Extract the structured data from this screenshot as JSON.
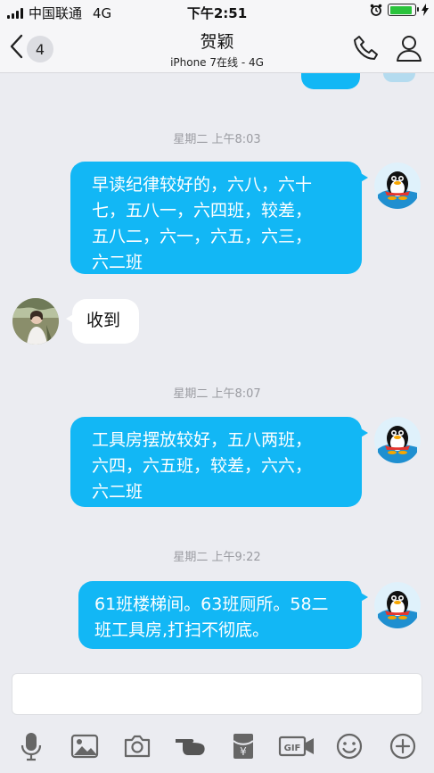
{
  "status_bar": {
    "carrier": "中国联通",
    "network": "4G",
    "time": "下午2:51",
    "battery_level": 0.9,
    "icons": [
      "signal-icon",
      "alarm-icon",
      "battery-icon",
      "charging-icon"
    ]
  },
  "header": {
    "back_count": "4",
    "title": "贺颖",
    "subtitle": "iPhone 7在线 - 4G",
    "icons": [
      "phone-icon",
      "profile-icon"
    ]
  },
  "messages": [
    {
      "timestamp": "星期二 上午8:03"
    },
    {
      "direction": "out",
      "text_lines": [
        "早读纪律较好的，六八，六十",
        "七，五八一，六四班，较差，",
        "五八二，六一，六五，六三，",
        "六二班"
      ]
    },
    {
      "direction": "in",
      "text_lines": [
        "收到"
      ]
    },
    {
      "timestamp": "星期二 上午8:07"
    },
    {
      "direction": "out",
      "text_lines": [
        "工具房摆放较好，五八两班，",
        "六四，六五班，较差，六六，",
        "六二班"
      ]
    },
    {
      "timestamp": "星期二 上午9:22"
    },
    {
      "direction": "out",
      "text_lines": [
        "61班楼梯间。63班厕所。58二",
        "班工具房,打扫不彻底。"
      ]
    }
  ],
  "composer": {
    "input_value": "",
    "toolbar_icons": [
      "microphone-icon",
      "image-icon",
      "camera-icon",
      "poke-icon",
      "red-packet-icon",
      "gif-icon",
      "emoji-icon",
      "plus-icon"
    ]
  },
  "colors": {
    "accent": "#12b7f5",
    "background": "#ebecf1",
    "battery": "#2ac33c"
  }
}
